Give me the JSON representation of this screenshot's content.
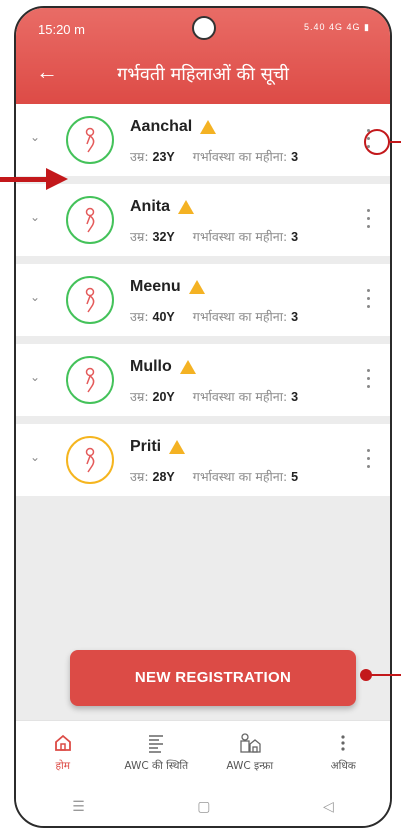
{
  "status_bar": {
    "time": "15:20",
    "carrier_glyph": "m",
    "icons_text": "5.40  4G  4G  ▮"
  },
  "header": {
    "title": "गर्भवती महिलाओं की सूची",
    "back_icon": "arrow-left-icon"
  },
  "labels": {
    "age": "उम्र:",
    "pregnancy_month": "गर्भावस्था का महीना:"
  },
  "women": [
    {
      "name": "Aanchal",
      "age": "23Y",
      "month": "3",
      "avatar_color": "green"
    },
    {
      "name": "Anita",
      "age": "32Y",
      "month": "3",
      "avatar_color": "green"
    },
    {
      "name": "Meenu",
      "age": "40Y",
      "month": "3",
      "avatar_color": "green"
    },
    {
      "name": "Mullo",
      "age": "20Y",
      "month": "3",
      "avatar_color": "green"
    },
    {
      "name": "Priti",
      "age": "28Y",
      "month": "5",
      "avatar_color": "yellow"
    }
  ],
  "cta": {
    "label": "NEW REGISTRATION"
  },
  "bottom_nav": [
    {
      "label": "होम",
      "icon": "home-icon",
      "active": true
    },
    {
      "label": "AWC की स्थिति",
      "icon": "list-icon",
      "active": false
    },
    {
      "label": "AWC इन्फ्रा",
      "icon": "building-icon",
      "active": false
    },
    {
      "label": "अधिक",
      "icon": "more-vertical-icon",
      "active": false
    }
  ],
  "colors": {
    "primary": "#dc4b46",
    "green": "#44c25a",
    "yellow": "#f5b51f",
    "warning": "#f4b223",
    "annotation": "#c3181b"
  }
}
